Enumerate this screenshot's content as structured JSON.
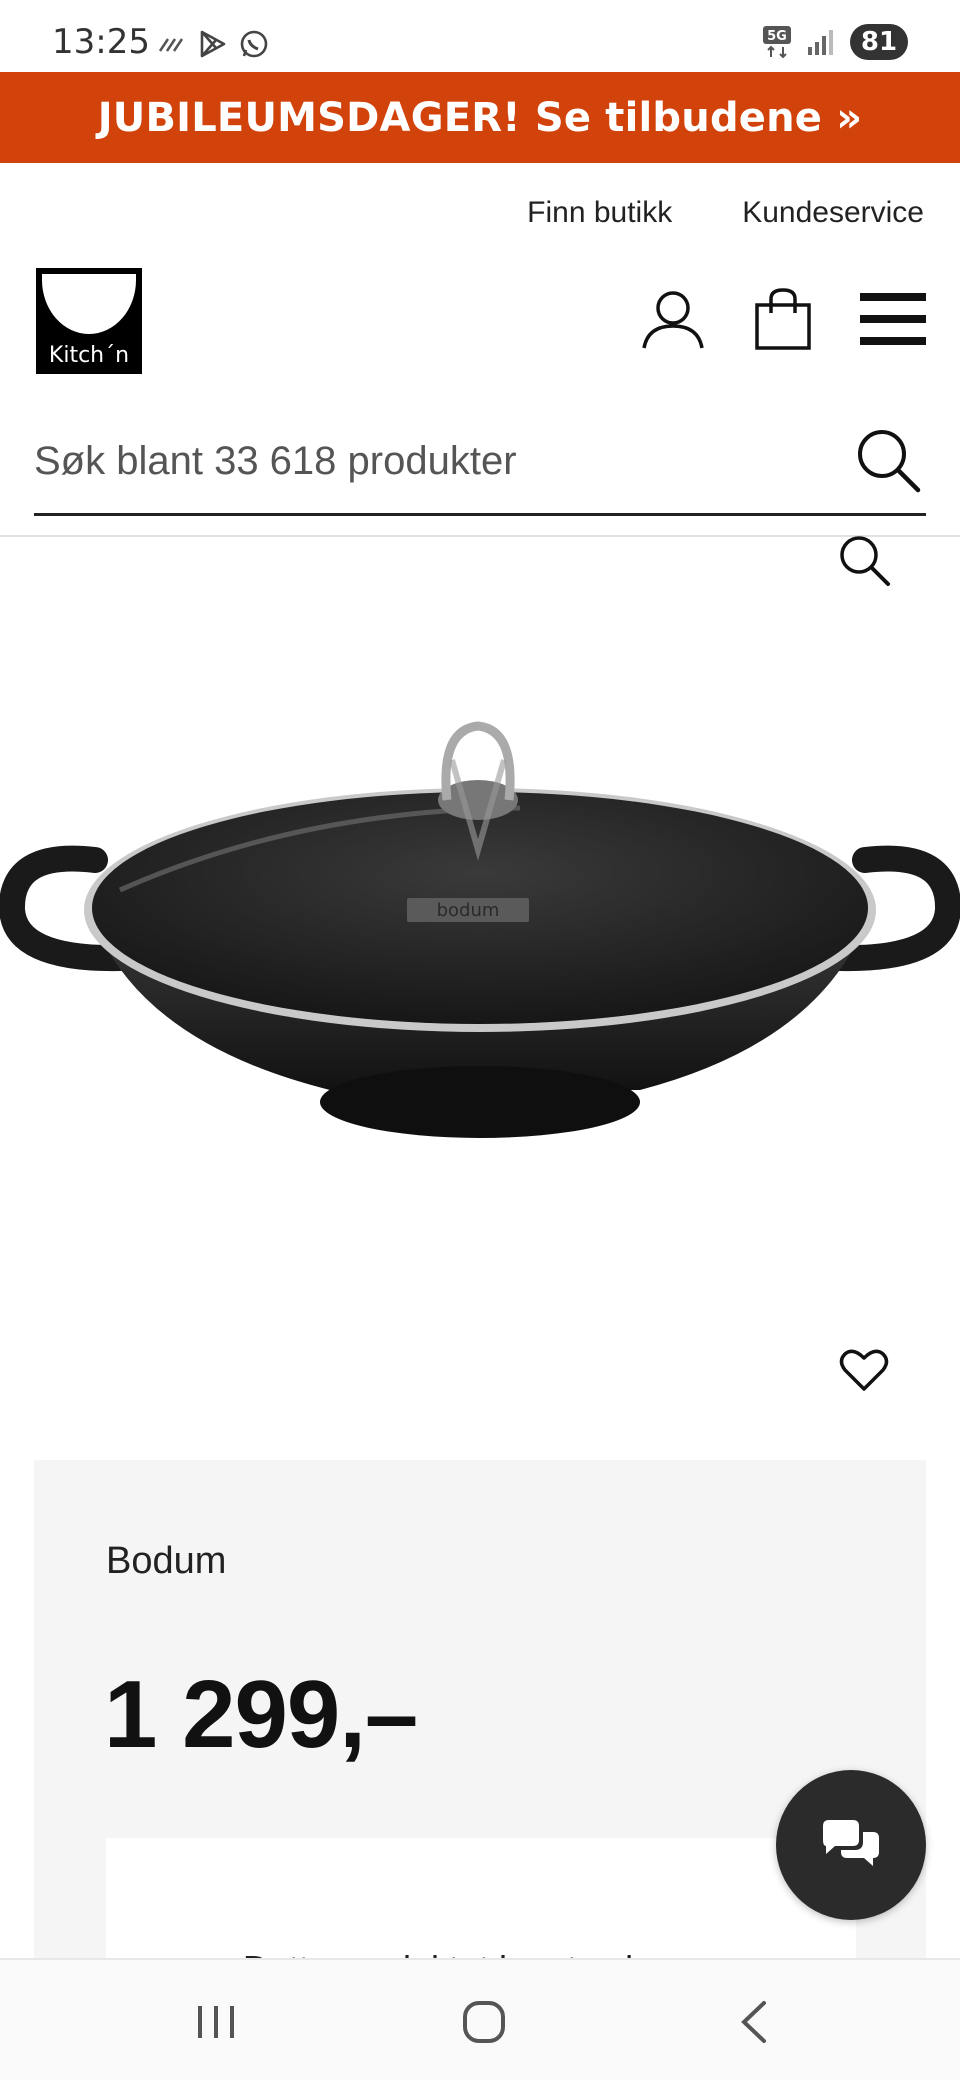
{
  "status_bar": {
    "time": "13:25",
    "network": "5G",
    "battery": "81"
  },
  "promo_banner": {
    "text": "JUBILEUMSDAGER! Se tilbudene »"
  },
  "top_links": {
    "find_store": "Finn butikk",
    "customer_service": "Kundeservice"
  },
  "header": {
    "logo_text": "Kitch´n"
  },
  "search": {
    "placeholder": "Søk blant 33 618 produkter"
  },
  "product": {
    "image_brand_mark": "bodum",
    "brand": "Bodum",
    "price": "1 299,–",
    "notice_text_partial": "Dette produktet kan tas kun…"
  },
  "colors": {
    "promo_bg": "#d2430b",
    "card_bg": "#f5f5f5",
    "chat_bg": "#2b2b2b"
  },
  "icons": {
    "account": "user-icon",
    "cart": "shopping-bag-icon",
    "menu": "hamburger-menu-icon",
    "search": "search-icon",
    "zoom": "zoom-icon",
    "favorite": "heart-icon",
    "chat": "chat-bubbles-icon"
  }
}
